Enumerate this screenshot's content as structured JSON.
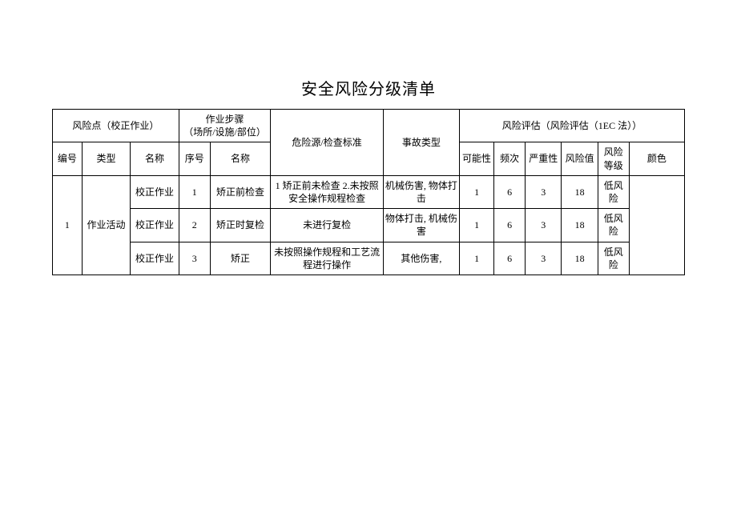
{
  "title": "安全风险分级清单",
  "header": {
    "risk_point_group": "风险点（校正作业）",
    "step_group": "作业步骤\n（场所/设施/部位）",
    "hazard": "危险源/检查标准",
    "accident": "事故类型",
    "assessment_group": "风险评估（风险评估（1EC 法））",
    "rp_no": "编号",
    "rp_type": "类型",
    "rp_name": "名称",
    "step_no": "序号",
    "step_name": "名称",
    "a_possibility": "可能性",
    "a_frequency": "频次",
    "a_severity": "严重性",
    "a_value": "风险值",
    "a_level": "风险\n等级",
    "a_color": "颜色"
  },
  "rows": [
    {
      "rp_no": "1",
      "rp_type": "作业活动",
      "rp_name": "校正作业",
      "step_no": "1",
      "step_name": "矫正前检查",
      "hazard": "1 矫正前未检查 2.未按照安全操作规程检查",
      "accident": "机械伤害, 物体打击",
      "p": "1",
      "f": "6",
      "s": "3",
      "v": "18",
      "lvl": "低风险",
      "color": ""
    },
    {
      "rp_no": "",
      "rp_type": "",
      "rp_name": "校正作业",
      "step_no": "2",
      "step_name": "矫正时复检",
      "hazard": "未进行复检",
      "accident": "物体打击, 机械伤害",
      "p": "1",
      "f": "6",
      "s": "3",
      "v": "18",
      "lvl": "低风险",
      "color": ""
    },
    {
      "rp_no": "",
      "rp_type": "",
      "rp_name": "校正作业",
      "step_no": "3",
      "step_name": "矫正",
      "hazard": "未按照操作规程和工艺流程进行操作",
      "accident": "其他伤害,",
      "p": "1",
      "f": "6",
      "s": "3",
      "v": "18",
      "lvl": "低风险",
      "color": ""
    }
  ],
  "chart_data": {
    "type": "table",
    "title": "安全风险分级清单",
    "columns": [
      "编号",
      "类型",
      "名称",
      "序号",
      "名称(步骤)",
      "危险源/检查标准",
      "事故类型",
      "可能性",
      "频次",
      "严重性",
      "风险值",
      "风险等级",
      "颜色"
    ],
    "rows": [
      [
        "1",
        "作业活动",
        "校正作业",
        "1",
        "矫正前检查",
        "1 矫正前未检查 2.未按照安全操作规程检查",
        "机械伤害, 物体打击",
        "1",
        "6",
        "3",
        "18",
        "低风险",
        ""
      ],
      [
        "1",
        "作业活动",
        "校正作业",
        "2",
        "矫正时复检",
        "未进行复检",
        "物体打击, 机械伤害",
        "1",
        "6",
        "3",
        "18",
        "低风险",
        ""
      ],
      [
        "1",
        "作业活动",
        "校正作业",
        "3",
        "矫正",
        "未按照操作规程和工艺流程进行操作",
        "其他伤害,",
        "1",
        "6",
        "3",
        "18",
        "低风险",
        ""
      ]
    ]
  }
}
